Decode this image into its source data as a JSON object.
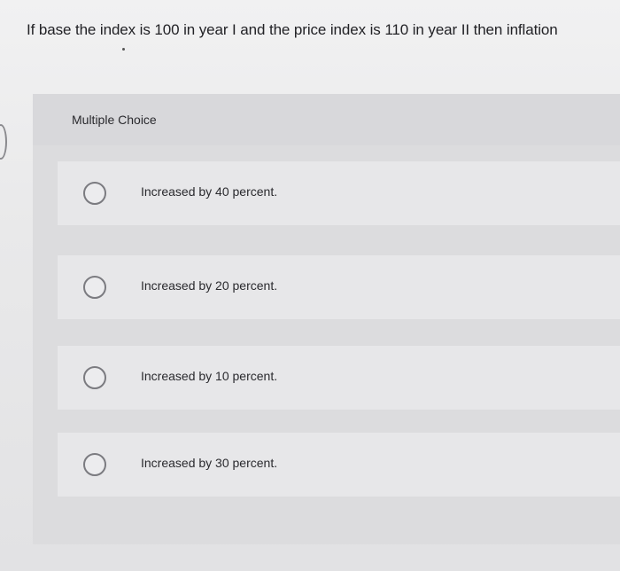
{
  "question": {
    "text": "If base the index is 100 in year I  and the price index is 110 in year II then inflation"
  },
  "section": {
    "label": "Multiple Choice"
  },
  "options": [
    {
      "label": "Increased by 40 percent."
    },
    {
      "label": "Increased by 20 percent."
    },
    {
      "label": "Increased by 10 percent."
    },
    {
      "label": "Increased by 30 percent."
    }
  ],
  "icons": {
    "radio": "radio-circle-icon"
  }
}
